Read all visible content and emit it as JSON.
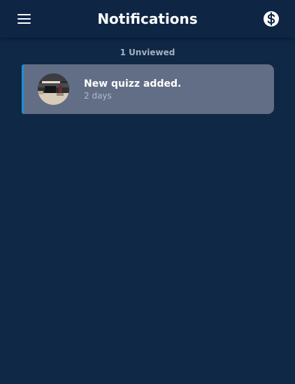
{
  "header": {
    "title": "Notifications",
    "menu_icon": "hamburger-menu-icon",
    "coin_icon": "dollar-coin-icon"
  },
  "status": {
    "unviewed": "1 Unviewed"
  },
  "notifications": [
    {
      "title": "New quizz added.",
      "time": "2 days",
      "avatar_icon": "camera-gear-photo",
      "unread_accent": "#1f8fd2"
    }
  ],
  "colors": {
    "background": "#0f2846",
    "header": "#0e2544",
    "card": "#626e86",
    "accent": "#1f8fd2"
  }
}
